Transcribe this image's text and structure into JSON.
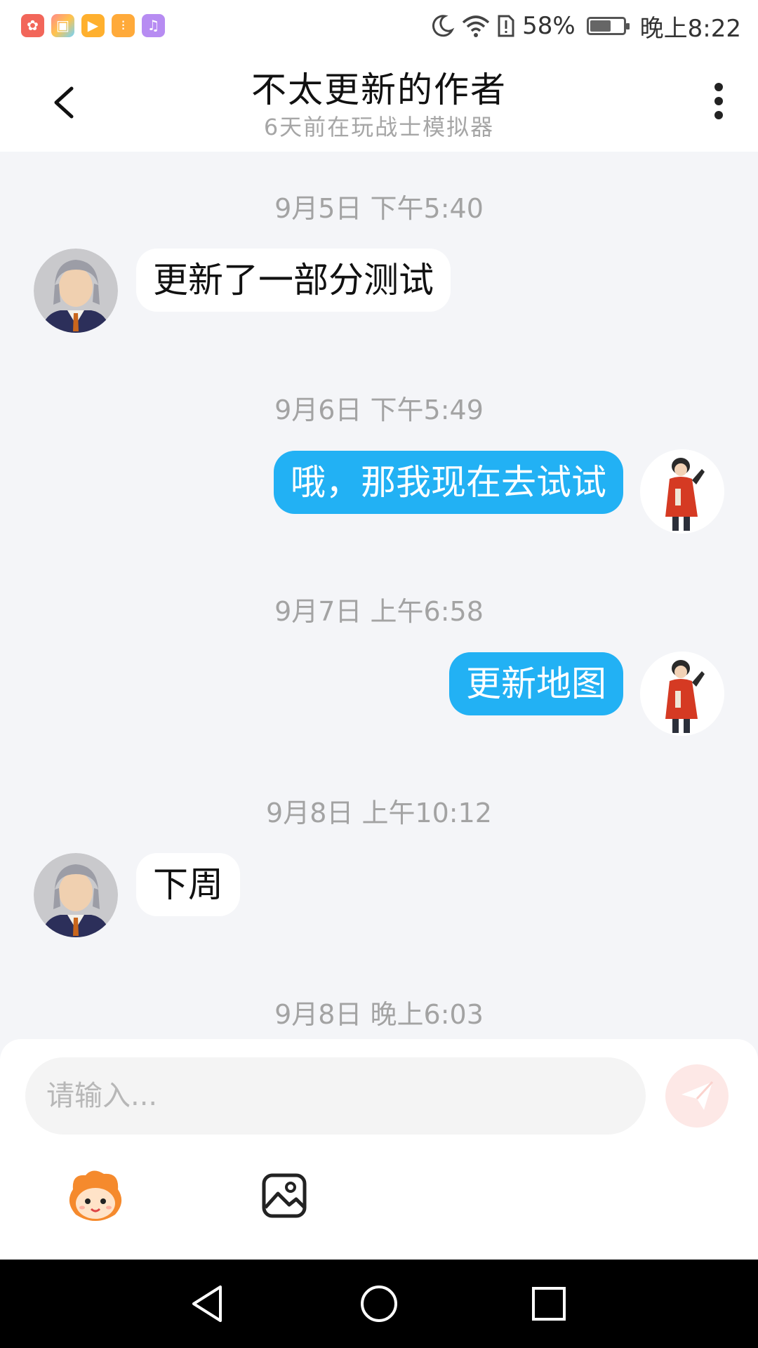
{
  "status_bar": {
    "battery": "58%",
    "time": "晚上8:22",
    "battery_level": 0.58,
    "notification_icons": [
      "huawei-app-icon",
      "theme-icon",
      "video-icon",
      "wallet-icon",
      "music-icon"
    ]
  },
  "header": {
    "title": "不太更新的作者",
    "subtitle": "6天前在玩战士模拟器"
  },
  "messages": [
    {
      "timestamp": "9月5日 下午5:40",
      "direction": "incoming",
      "text": "更新了一部分测试"
    },
    {
      "timestamp": "9月6日 下午5:49",
      "direction": "outgoing",
      "text": "哦，那我现在去试试"
    },
    {
      "timestamp": "9月7日 上午6:58",
      "direction": "outgoing",
      "text": "更新地图"
    },
    {
      "timestamp": "9月8日 上午10:12",
      "direction": "incoming",
      "text": "下周"
    },
    {
      "timestamp": "9月8日 晚上6:03",
      "direction": "",
      "text": ""
    }
  ],
  "input": {
    "placeholder": "请输入..."
  },
  "colors": {
    "outgoing_bubble": "#22b1f4",
    "incoming_bubble": "#ffffff",
    "chat_background": "#f4f5f8",
    "send_button": "#fde8e6"
  },
  "icons": {
    "back": "chevron-left-icon",
    "more": "more-vertical-icon",
    "send": "send-icon",
    "emoji": "emoji-mascot-icon",
    "image": "image-icon"
  }
}
